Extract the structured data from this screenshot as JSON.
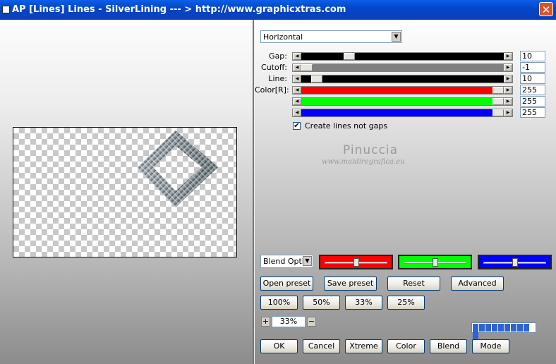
{
  "window": {
    "title": "AP [Lines]  Lines - SilverLining     --- > http://www.graphicxtras.com",
    "close_symbol": "✕"
  },
  "direction": {
    "selected": "Horizontal"
  },
  "sliders": [
    {
      "id": "gap",
      "label": "Gap:",
      "value": "10",
      "fill_color": "#000000",
      "level": 0.22
    },
    {
      "id": "cutoff",
      "label": "Cutoff:",
      "value": "-1",
      "fill_color": "#808080",
      "level": 0.0
    },
    {
      "id": "line",
      "label": "Line:",
      "value": "10",
      "fill_color": "#000000",
      "level": 0.05
    },
    {
      "id": "color-r",
      "label": "Color[R]:",
      "value": "255",
      "fill_color": "#ff0000",
      "level": 1.0
    },
    {
      "id": "color-g",
      "label": "",
      "value": "255",
      "fill_color": "#00ff00",
      "level": 1.0
    },
    {
      "id": "color-b",
      "label": "",
      "value": "255",
      "fill_color": "#0000ff",
      "level": 1.0
    }
  ],
  "option": {
    "label": "Create lines not gaps",
    "checked": true,
    "mark": "✔"
  },
  "watermark": {
    "name": "Pinuccia",
    "url": "www.maidiregrafica.eu"
  },
  "blend": {
    "selected": "Blend Opti",
    "colors": [
      "#ff0000",
      "#00ff00",
      "#0000ff"
    ],
    "levels": [
      0.5,
      0.5,
      0.5
    ]
  },
  "preset_buttons": {
    "open": "Open preset",
    "save": "Save preset",
    "reset": "Reset",
    "advanced": "Advanced"
  },
  "zoom_buttons": [
    "100%",
    "50%",
    "33%",
    "25%"
  ],
  "zoom": {
    "plus": "+",
    "value": "33%",
    "minus": "−"
  },
  "progress": {
    "segments": 10,
    "level": 1.0
  },
  "bottom_buttons": {
    "ok": "OK",
    "cancel": "Cancel",
    "xtreme": "Xtreme",
    "color": "Color",
    "blend": "Blend",
    "mode": "Mode"
  },
  "colors": {
    "title_bar": "#0446c9",
    "button_border": "#003c74"
  }
}
